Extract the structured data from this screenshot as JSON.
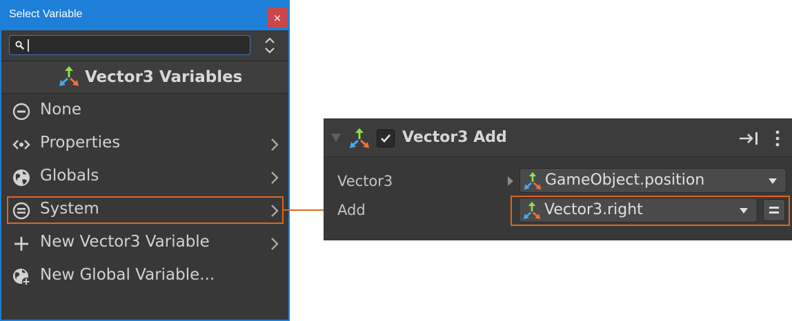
{
  "select_window": {
    "title": "Select Variable",
    "close_label": "×",
    "search": {
      "value": "",
      "placeholder": ""
    },
    "header_title": "Vector3 Variables",
    "items": [
      {
        "label": "None",
        "icon": "none-circle-icon",
        "has_submenu": false
      },
      {
        "label": "Properties",
        "icon": "properties-icon",
        "has_submenu": true
      },
      {
        "label": "Globals",
        "icon": "globe-icon",
        "has_submenu": true
      },
      {
        "label": "System",
        "icon": "system-icon",
        "has_submenu": true,
        "highlighted": true
      },
      {
        "label": "New Vector3 Variable",
        "icon": "plus-icon",
        "has_submenu": true
      },
      {
        "label": "New Global Variable...",
        "icon": "globe-add-icon",
        "has_submenu": false
      }
    ]
  },
  "action_panel": {
    "title": "Vector3 Add",
    "enabled": true,
    "fields": [
      {
        "label": "Vector3",
        "value": "GameObject.position"
      },
      {
        "label": "Add",
        "value": "Vector3.right",
        "highlighted": true
      }
    ]
  },
  "colors": {
    "window_border": "#1e7fd8",
    "close_button": "#c9474a",
    "highlight": "#e0661e",
    "panel_bg": "#383838",
    "text": "#d2d2d2"
  }
}
